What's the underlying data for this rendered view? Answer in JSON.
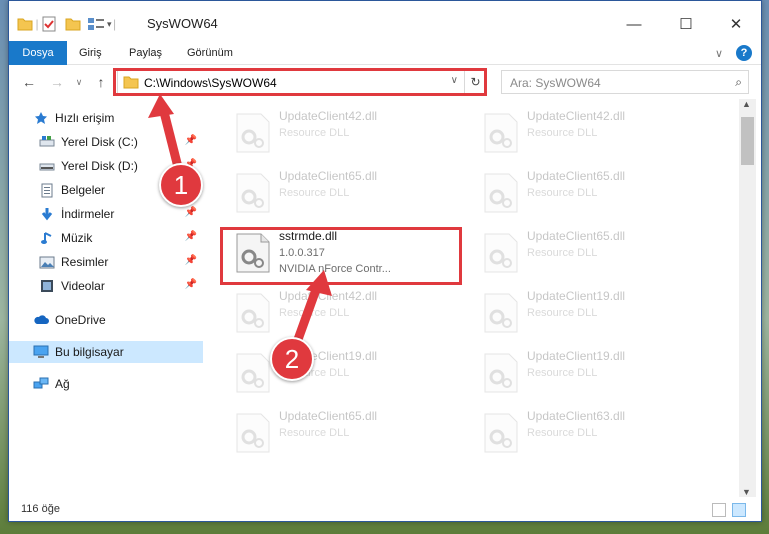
{
  "window": {
    "title": "SysWOW64",
    "minimize": "—",
    "maximize": "☐",
    "close": "✕"
  },
  "ribbon": {
    "file_tab": "Dosya",
    "tabs": [
      "Giriş",
      "Paylaş",
      "Görünüm"
    ],
    "collapse": "∨",
    "help": "?"
  },
  "nav": {
    "back": "←",
    "forward": "→",
    "recent": "∨",
    "up": "↑",
    "address": "C:\\Windows\\SysWOW64",
    "dropdown": "∨",
    "refresh": "↻",
    "search_placeholder": "Ara: SysWOW64"
  },
  "sidebar": {
    "items": [
      {
        "label": "Hızlı erişim",
        "icon": "star-icon",
        "pinned": false
      },
      {
        "label": "Yerel Disk (C:)",
        "icon": "drive-icon",
        "pinned": true
      },
      {
        "label": "Yerel Disk (D:)",
        "icon": "drive-icon",
        "pinned": true
      },
      {
        "label": "Belgeler",
        "icon": "document-icon",
        "pinned": true
      },
      {
        "label": "İndirmeler",
        "icon": "download-icon",
        "pinned": true
      },
      {
        "label": "Müzik",
        "icon": "music-icon",
        "pinned": true
      },
      {
        "label": "Resimler",
        "icon": "picture-icon",
        "pinned": true
      },
      {
        "label": "Videolar",
        "icon": "video-icon",
        "pinned": true
      },
      {
        "label": "OneDrive",
        "icon": "cloud-icon",
        "pinned": false
      },
      {
        "label": "Bu bilgisayar",
        "icon": "computer-icon",
        "pinned": false
      },
      {
        "label": "Ağ",
        "icon": "network-icon",
        "pinned": false
      }
    ]
  },
  "files": {
    "left": [
      {
        "name": "UpdateClient42.dll",
        "type": "Resource DLL"
      },
      {
        "name": "UpdateClient65.dll",
        "type": "Resource DLL"
      },
      {
        "name": "sstrmde.dll",
        "version": "1.0.0.317",
        "company": "NVIDIA nForce Contr..."
      },
      {
        "name": "UpdateClient42.dll",
        "type": "Resource DLL"
      },
      {
        "name": "UpdateClient19.dll",
        "type": "Resource DLL"
      },
      {
        "name": "UpdateClient65.dll",
        "type": "Resource DLL"
      }
    ],
    "right": [
      {
        "name": "UpdateClient42.dll",
        "type": "Resource DLL"
      },
      {
        "name": "UpdateClient65.dll",
        "type": "Resource DLL"
      },
      {
        "name": "UpdateClient65.dll",
        "type": "Resource DLL"
      },
      {
        "name": "UpdateClient19.dll",
        "type": "Resource DLL"
      },
      {
        "name": "UpdateClient19.dll",
        "type": "Resource DLL"
      },
      {
        "name": "UpdateClient63.dll",
        "type": "Resource DLL"
      }
    ]
  },
  "status": {
    "count": "116 öğe"
  },
  "annotations": {
    "step1": "1",
    "step2": "2",
    "color": "#e0393e"
  }
}
